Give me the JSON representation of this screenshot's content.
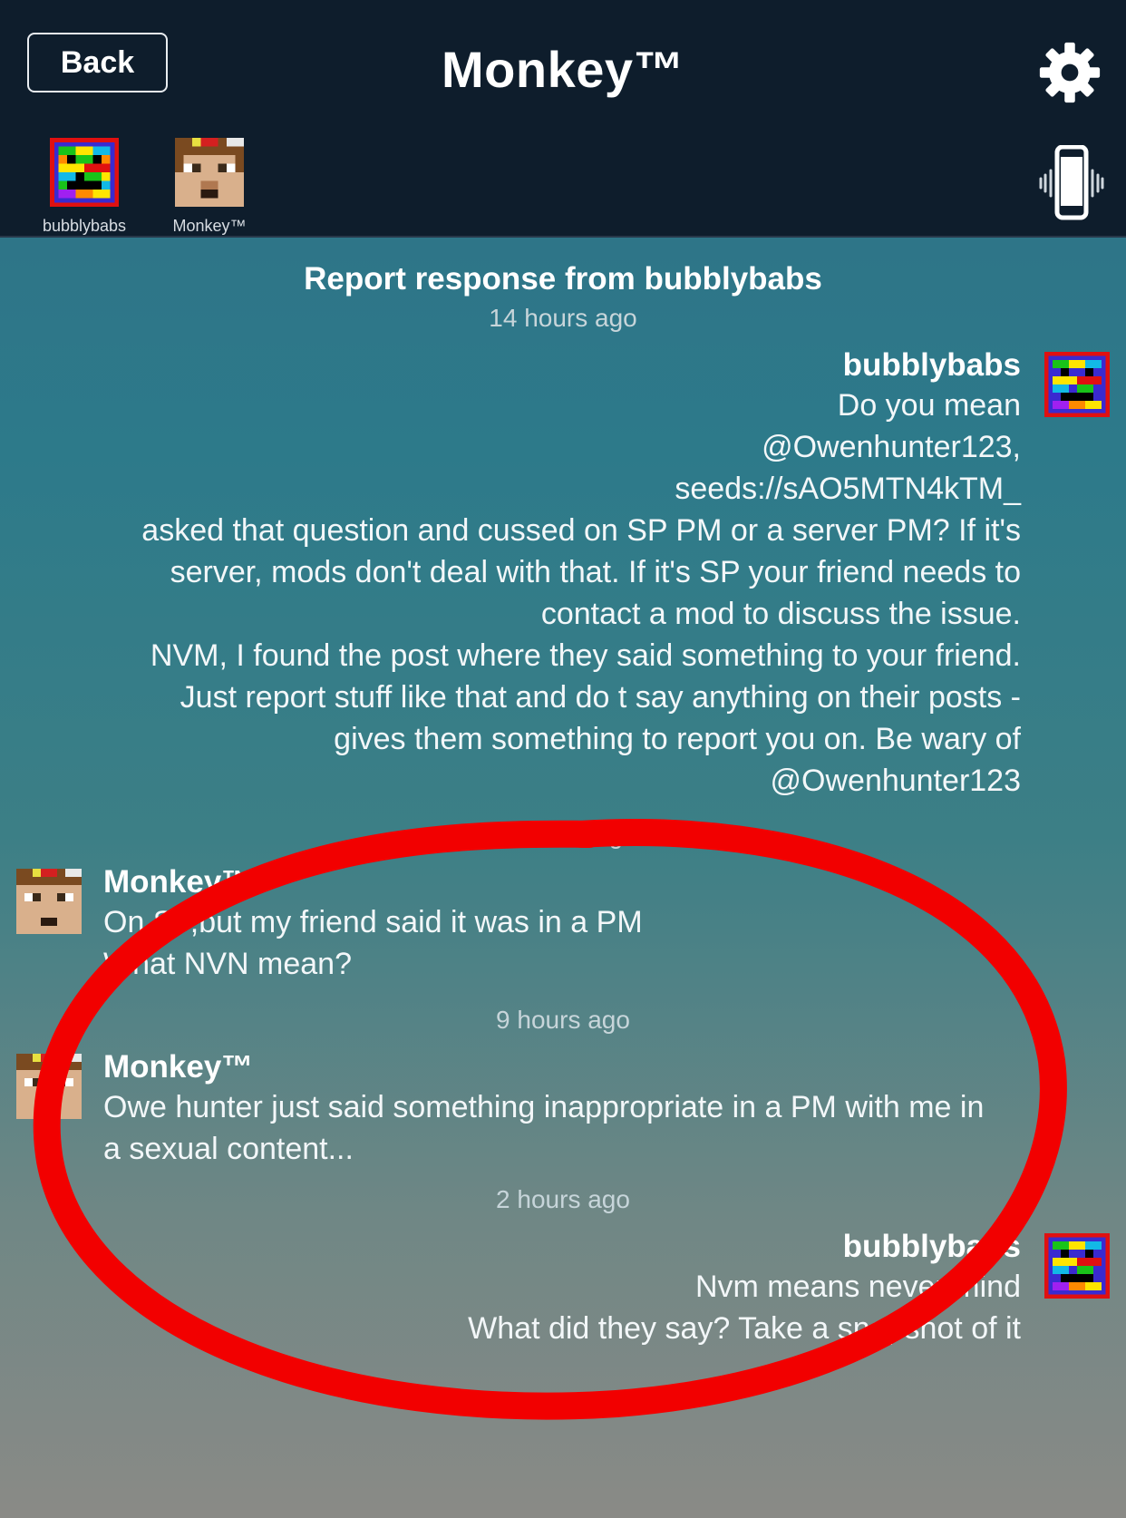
{
  "header": {
    "back_label": "Back",
    "title": "Monkey™",
    "participants": [
      {
        "name": "bubblybabs"
      },
      {
        "name": "Monkey™"
      }
    ]
  },
  "conversation": {
    "title": "Report response from bubblybabs",
    "messages": [
      {
        "timestamp": "14 hours ago",
        "sender": "bubblybabs",
        "lines": [
          "Do you mean",
          "@Owenhunter123,",
          "seeds://sAO5MTN4kTM_",
          "asked that question and cussed on SP PM or a server PM?  If it's",
          "server, mods don't deal with that.  If it's SP your friend needs to",
          "contact a mod to discuss the issue.",
          "NVM, I found the post where they said something to your friend.",
          "Just report stuff like that and do t say anything on their posts -",
          "gives them something to report you on.  Be wary of",
          "@Owenhunter123"
        ]
      },
      {
        "timestamp": "10 hours ago",
        "sender": "Monkey™",
        "lines": [
          "On SP,but my friend said it was in a PM",
          "What NVN mean?"
        ]
      },
      {
        "timestamp": "9 hours ago",
        "sender": "Monkey™",
        "lines": [
          "Owe hunter just said something inappropriate in a PM with me in",
          "a sexual content..."
        ]
      },
      {
        "timestamp": "2 hours ago",
        "sender": "bubblybabs",
        "lines": [
          "Nvm means never mind",
          "What did they say?  Take a snapshot of it"
        ]
      }
    ]
  },
  "colors": {
    "topbar": "#0e1d2c",
    "annotation": "#f20000"
  }
}
